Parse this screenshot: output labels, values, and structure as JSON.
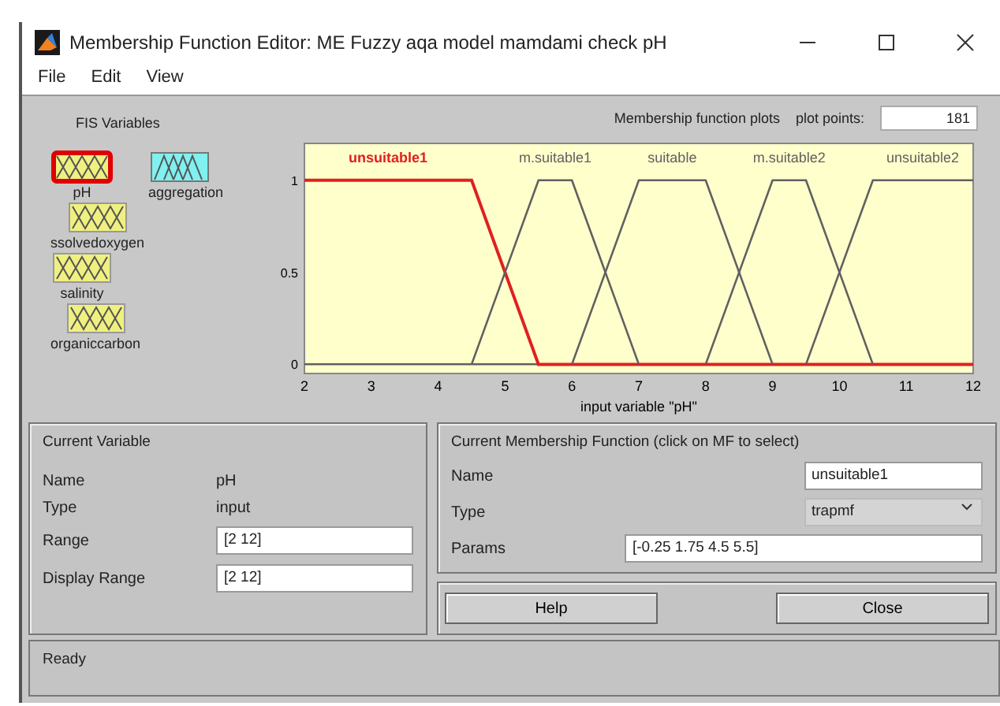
{
  "window": {
    "title": "Membership Function Editor: ME Fuzzy aqa model mamdami check pH"
  },
  "menu": [
    "File",
    "Edit",
    "View"
  ],
  "fis_variables": {
    "heading": "FIS Variables",
    "items": [
      {
        "label": "pH",
        "kind": "input",
        "selected": true
      },
      {
        "label": "aggregation",
        "kind": "aggregation",
        "selected": false
      },
      {
        "label": "ssolvedoxygen",
        "kind": "input",
        "selected": false
      },
      {
        "label": "salinity",
        "kind": "input",
        "selected": false
      },
      {
        "label": "organiccarbon",
        "kind": "input",
        "selected": false
      }
    ]
  },
  "plot_points": {
    "label": "plot points:",
    "value": "181"
  },
  "chart_data": {
    "type": "line",
    "title": "Membership function plots",
    "xlabel": "input variable \"pH\"",
    "x": [
      2,
      4.5,
      5,
      5.5,
      6,
      6.5,
      7,
      8,
      8.5,
      9,
      9.5,
      10,
      10.5,
      12
    ],
    "series": [
      {
        "name": "unsuitable1",
        "color": "#e02020",
        "values": [
          1,
          1,
          0.5,
          0,
          0,
          0,
          0,
          0,
          0,
          0,
          0,
          0,
          0,
          0
        ]
      },
      {
        "name": "m.suitable1",
        "color": "#606060",
        "values": [
          null,
          0,
          0.5,
          1,
          1,
          0.5,
          0,
          null,
          null,
          null,
          null,
          null,
          null,
          null
        ]
      },
      {
        "name": "suitable",
        "color": "#606060",
        "values": [
          null,
          null,
          null,
          null,
          0,
          0.5,
          1,
          1,
          0.5,
          0,
          null,
          null,
          null,
          null
        ]
      },
      {
        "name": "m.suitable2",
        "color": "#606060",
        "values": [
          null,
          null,
          null,
          null,
          null,
          null,
          null,
          0,
          0.5,
          1,
          1,
          0.5,
          0,
          null
        ]
      },
      {
        "name": "unsuitable2",
        "color": "#606060",
        "values": [
          null,
          null,
          null,
          null,
          null,
          null,
          null,
          null,
          null,
          null,
          0,
          0.5,
          1,
          1
        ]
      }
    ],
    "xlim": [
      2,
      12
    ],
    "ylim": [
      -0.05,
      1.2
    ],
    "xticks": [
      2,
      3,
      4,
      5,
      6,
      7,
      8,
      9,
      10,
      11,
      12
    ],
    "yticks": [
      0,
      0.5,
      1
    ]
  },
  "current_variable": {
    "heading": "Current Variable",
    "name_label": "Name",
    "name": "pH",
    "type_label": "Type",
    "type": "input",
    "range_label": "Range",
    "range": "[2 12]",
    "display_range_label": "Display Range",
    "display_range": "[2 12]"
  },
  "current_mf": {
    "heading": "Current Membership Function (click on MF to select)",
    "name_label": "Name",
    "name": "unsuitable1",
    "type_label": "Type",
    "type": "trapmf",
    "params_label": "Params",
    "params": "[-0.25 1.75 4.5 5.5]"
  },
  "buttons": [
    "Help",
    "Close"
  ],
  "status_bar": "Ready"
}
